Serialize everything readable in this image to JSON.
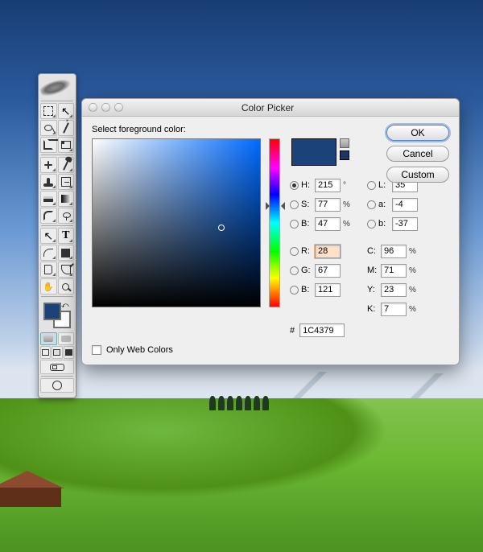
{
  "dialog": {
    "title": "Color Picker",
    "prompt": "Select foreground color:",
    "buttons": {
      "ok": "OK",
      "cancel": "Cancel",
      "custom": "Custom"
    },
    "only_web_colors": "Only Web Colors",
    "hex_prefix": "#",
    "picker": {
      "hue_pos_pct": 40,
      "marker_x_pct": 77,
      "marker_y_pct": 53
    },
    "hsb": {
      "H": {
        "label": "H:",
        "value": "215",
        "unit": "°",
        "selected": true
      },
      "S": {
        "label": "S:",
        "value": "77",
        "unit": "%"
      },
      "B": {
        "label": "B:",
        "value": "47",
        "unit": "%"
      }
    },
    "lab": {
      "L": {
        "label": "L:",
        "value": "35"
      },
      "a": {
        "label": "a:",
        "value": "-4"
      },
      "b": {
        "label": "b:",
        "value": "-37"
      }
    },
    "rgb": {
      "R": {
        "label": "R:",
        "value": "28"
      },
      "G": {
        "label": "G:",
        "value": "67"
      },
      "B": {
        "label": "B:",
        "value": "121"
      }
    },
    "cmyk": {
      "C": {
        "label": "C:",
        "value": "96",
        "unit": "%"
      },
      "M": {
        "label": "M:",
        "value": "71",
        "unit": "%"
      },
      "Y": {
        "label": "Y:",
        "value": "23",
        "unit": "%"
      },
      "K": {
        "label": "K:",
        "value": "7",
        "unit": "%"
      }
    },
    "hex": "1C4379",
    "swatch": {
      "current": "#1c4379",
      "previous": "#1c3565"
    }
  },
  "toolbar": {
    "foreground": "#1c4379",
    "background": "#ffffff"
  }
}
